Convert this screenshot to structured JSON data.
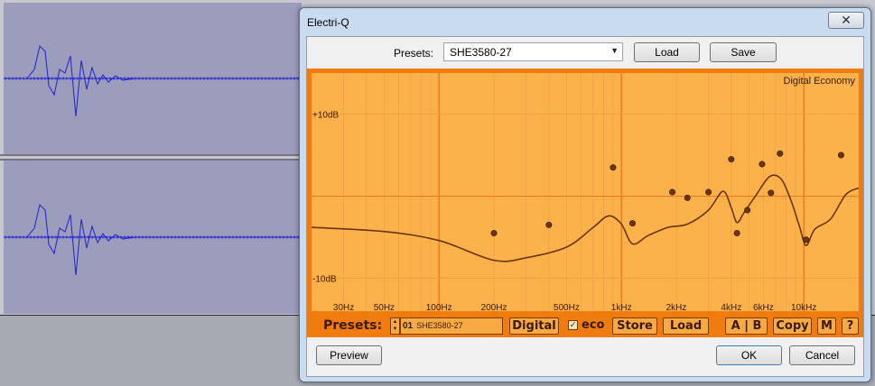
{
  "window": {
    "title": "Electri-Q",
    "close_glyph": "✕"
  },
  "top_bar": {
    "presets_label": "Presets:",
    "preset_value": "SHE3580-27",
    "load_label": "Load",
    "save_label": "Save"
  },
  "eq": {
    "mode_label": "Digital Economy",
    "db_labels": [
      "+10dB",
      "-10dB"
    ],
    "db_range": [
      -14,
      15
    ],
    "freq_range": [
      20,
      20000
    ],
    "freq_labels": [
      {
        "text": "30Hz",
        "hz": 30
      },
      {
        "text": "50Hz",
        "hz": 50
      },
      {
        "text": "100Hz",
        "hz": 100
      },
      {
        "text": "200Hz",
        "hz": 200
      },
      {
        "text": "500Hz",
        "hz": 500
      },
      {
        "text": "1kHz",
        "hz": 1000
      },
      {
        "text": "2kHz",
        "hz": 2000
      },
      {
        "text": "4kHz",
        "hz": 4000
      },
      {
        "text": "6kHz",
        "hz": 6000
      },
      {
        "text": "10kHz",
        "hz": 10000
      }
    ],
    "points": [
      {
        "hz": 200,
        "db": -4.5
      },
      {
        "hz": 400,
        "db": -3.5
      },
      {
        "hz": 900,
        "db": 3.5
      },
      {
        "hz": 1150,
        "db": -3.3
      },
      {
        "hz": 1900,
        "db": 0.5
      },
      {
        "hz": 2300,
        "db": -0.2
      },
      {
        "hz": 3000,
        "db": 0.5
      },
      {
        "hz": 4000,
        "db": 4.5
      },
      {
        "hz": 4300,
        "db": -4.5
      },
      {
        "hz": 4900,
        "db": -1.7
      },
      {
        "hz": 5900,
        "db": 3.9
      },
      {
        "hz": 6600,
        "db": 0.4
      },
      {
        "hz": 7400,
        "db": 5.2
      },
      {
        "hz": 10300,
        "db": -5.3
      },
      {
        "hz": 16000,
        "db": 5.0
      }
    ],
    "curve": [
      {
        "hz": 20,
        "db": -3.8
      },
      {
        "hz": 50,
        "db": -4.3
      },
      {
        "hz": 100,
        "db": -5.4
      },
      {
        "hz": 200,
        "db": -7.8
      },
      {
        "hz": 300,
        "db": -7.5
      },
      {
        "hz": 500,
        "db": -6.2
      },
      {
        "hz": 700,
        "db": -3.8
      },
      {
        "hz": 850,
        "db": -2.4
      },
      {
        "hz": 1000,
        "db": -3.4
      },
      {
        "hz": 1150,
        "db": -5.8
      },
      {
        "hz": 1400,
        "db": -4.8
      },
      {
        "hz": 1800,
        "db": -3.8
      },
      {
        "hz": 2300,
        "db": -3.4
      },
      {
        "hz": 3000,
        "db": -1.7
      },
      {
        "hz": 3600,
        "db": 0.6
      },
      {
        "hz": 4000,
        "db": -1.4
      },
      {
        "hz": 4300,
        "db": -3.2
      },
      {
        "hz": 4700,
        "db": -2.0
      },
      {
        "hz": 5500,
        "db": 0.2
      },
      {
        "hz": 6500,
        "db": 2.4
      },
      {
        "hz": 7500,
        "db": 2.1
      },
      {
        "hz": 8500,
        "db": -0.5
      },
      {
        "hz": 9500,
        "db": -3.8
      },
      {
        "hz": 10300,
        "db": -6.0
      },
      {
        "hz": 11500,
        "db": -4.0
      },
      {
        "hz": 14000,
        "db": -2.8
      },
      {
        "hz": 17000,
        "db": 0.2
      },
      {
        "hz": 20000,
        "db": 1.0
      }
    ]
  },
  "plugin_bar": {
    "presets_label": "Presets:",
    "preset_number": "01",
    "preset_name": "SHE3580-27",
    "digital_label": "Digital",
    "eco_checked": "✓",
    "eco_label": "eco",
    "store_label": "Store",
    "load_label": "Load",
    "ab_label": "A | B",
    "copy_label": "Copy",
    "m_label": "M",
    "help_label": "?"
  },
  "footer": {
    "preview_label": "Preview",
    "ok_label": "OK",
    "cancel_label": "Cancel"
  },
  "colors": {
    "panel_orange": "#f07c10",
    "grid_bg": "#fbb24a",
    "curve": "#6a3510",
    "point": "#6a3510",
    "waveform": "#2020d0"
  }
}
